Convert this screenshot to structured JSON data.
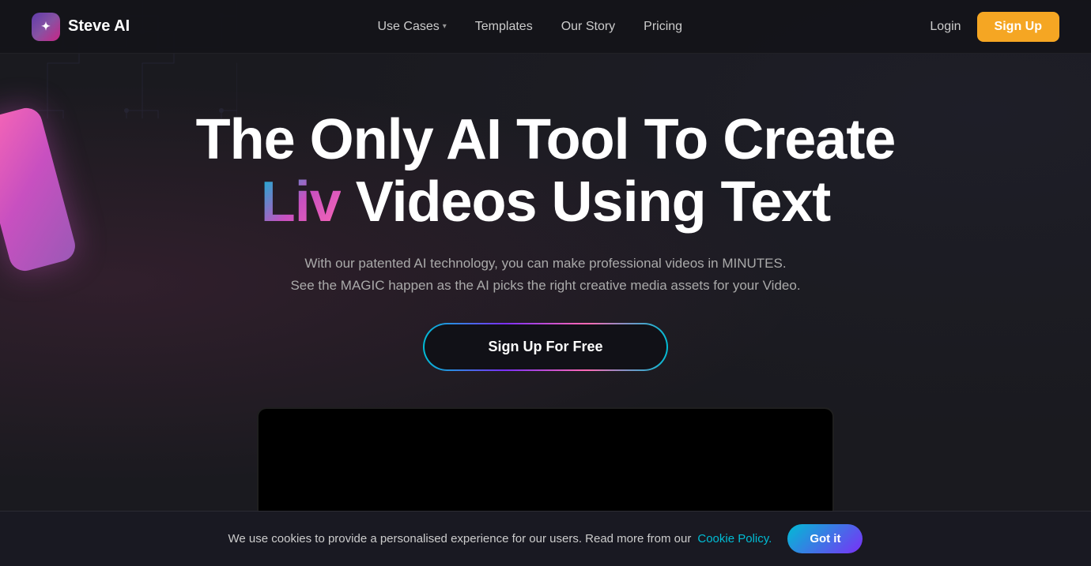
{
  "brand": {
    "logo_icon_text": "✦",
    "name": "Steve AI"
  },
  "nav": {
    "links": [
      {
        "id": "use-cases",
        "label": "Use Cases",
        "has_chevron": true
      },
      {
        "id": "templates",
        "label": "Templates",
        "has_chevron": false
      },
      {
        "id": "our-story",
        "label": "Our Story",
        "has_chevron": false
      },
      {
        "id": "pricing",
        "label": "Pricing",
        "has_chevron": false
      }
    ],
    "login_label": "Login",
    "signup_label": "Sign Up"
  },
  "hero": {
    "title_part1": "The Only AI Tool To Create ",
    "title_liv": "Liv",
    "title_part2": " Videos Using Text",
    "subtitle_line1": "With our patented AI technology, you can make professional videos in MINUTES.",
    "subtitle_line2": "See the MAGIC happen as the AI picks the right creative media assets for your Video.",
    "cta_label": "Sign Up For Free"
  },
  "cookie": {
    "text": "We use cookies to provide a personalised experience for our users. Read more from our ",
    "link_text": "Cookie Policy.",
    "button_label": "Got it"
  }
}
